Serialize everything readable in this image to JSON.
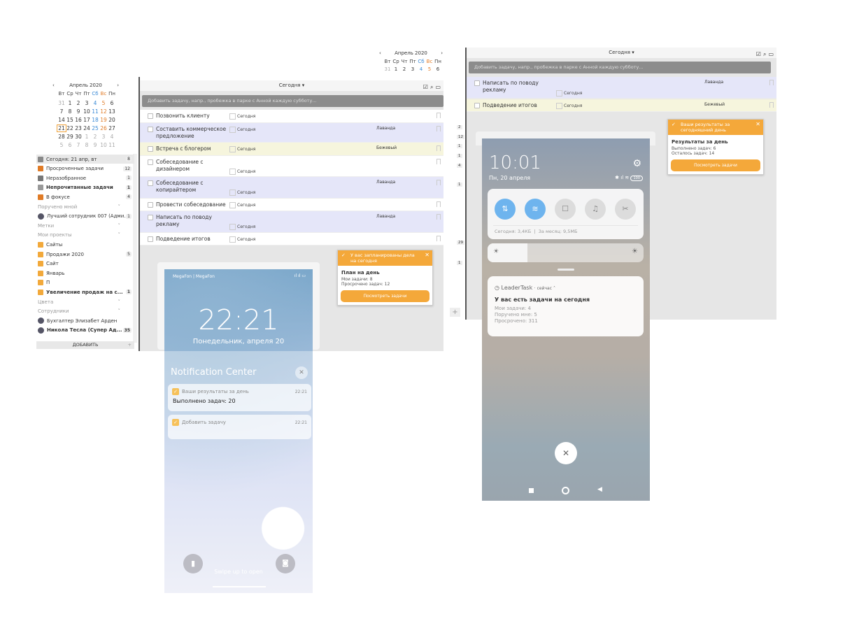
{
  "top_calendar": {
    "month": "Апрель 2020",
    "weekdays": [
      "Вт",
      "Ср",
      "Чт",
      "Пт",
      "Сб",
      "Вс",
      "Пн"
    ],
    "days": [
      "31",
      "1",
      "2",
      "3",
      "4",
      "5",
      "6"
    ]
  },
  "left_calendar": {
    "month": "Апрель 2020",
    "weekdays": [
      "Вт",
      "Ср",
      "Чт",
      "Пт",
      "Сб",
      "Вс",
      "Пн"
    ],
    "weeks": [
      [
        "31",
        "1",
        "2",
        "3",
        "4",
        "5",
        "6"
      ],
      [
        "7",
        "8",
        "9",
        "10",
        "11",
        "12",
        "13"
      ],
      [
        "14",
        "15",
        "16",
        "17",
        "18",
        "19",
        "20"
      ],
      [
        "21",
        "22",
        "23",
        "24",
        "25",
        "26",
        "27"
      ],
      [
        "28",
        "29",
        "30",
        "1",
        "2",
        "3",
        "4"
      ],
      [
        "5",
        "6",
        "7",
        "8",
        "9",
        "10",
        "11"
      ]
    ],
    "today": "21"
  },
  "sidebar": {
    "items": [
      {
        "label": "Сегодня: 21 апр, вт",
        "badge": "8",
        "icon": "calendar-icon",
        "type": "item"
      },
      {
        "label": "Просроченные задачи",
        "badge": "12",
        "icon": "overdue-icon",
        "type": "item"
      },
      {
        "label": "Неразобранное",
        "badge": "1",
        "icon": "inbox-icon",
        "type": "item"
      },
      {
        "label": "Непрочитанные задачи",
        "badge": "1",
        "icon": "bell-icon",
        "type": "bold"
      },
      {
        "label": "В фокусе",
        "badge": "4",
        "icon": "bookmark-icon",
        "type": "item"
      },
      {
        "label": "Поручено мной",
        "badge": "",
        "icon": "",
        "type": "section"
      },
      {
        "label": "Лучший сотрудник 007 (Адми...",
        "badge": "1",
        "icon": "avatar-icon",
        "type": "item"
      },
      {
        "label": "Метки",
        "badge": "",
        "icon": "",
        "type": "section"
      },
      {
        "label": "Мои проекты",
        "badge": "",
        "icon": "",
        "type": "section"
      },
      {
        "label": "Сайты",
        "badge": "",
        "icon": "folder-icon",
        "type": "item"
      },
      {
        "label": "Продажи 2020",
        "badge": "5",
        "icon": "folder-icon",
        "type": "item"
      },
      {
        "label": "Сайт",
        "badge": "",
        "icon": "folder-icon",
        "type": "item"
      },
      {
        "label": "Январь",
        "badge": "",
        "icon": "folder-icon",
        "type": "item"
      },
      {
        "label": "П",
        "badge": "",
        "icon": "folder-icon",
        "type": "item"
      },
      {
        "label": "Увеличение продаж на с...",
        "badge": "1",
        "icon": "folder-icon",
        "type": "bold"
      },
      {
        "label": "Цвета",
        "badge": "",
        "icon": "",
        "type": "section"
      },
      {
        "label": "Сотрудники",
        "badge": "",
        "icon": "",
        "type": "section"
      },
      {
        "label": "Бухгалтер Элизабет Арден",
        "badge": "",
        "icon": "avatar-icon",
        "type": "item"
      },
      {
        "label": "Никола Тесла (Супер Ад...",
        "badge": "35",
        "icon": "avatar-icon",
        "type": "bold"
      }
    ],
    "add_label": "ДОБАВИТЬ"
  },
  "main": {
    "view": "Сегодня",
    "input_placeholder": "Добавить задачу, напр., пробежка в парке с Анной каждую субботу...",
    "tasks": [
      {
        "title": "Позвонить клиенту",
        "date": "Сегодня",
        "tag": "",
        "color": "white"
      },
      {
        "title": "Составить коммерческое предложение",
        "date": "Сегодня",
        "tag": "Лаванда",
        "color": "lavender"
      },
      {
        "title": "Встреча с блогером",
        "date": "Сегодня",
        "tag": "Бежевый",
        "color": "beige"
      },
      {
        "title": "Собеседование с дизайнером",
        "date": "Сегодня",
        "tag": "",
        "color": "white"
      },
      {
        "title": "Собеседование с копирайтером",
        "date": "Сегодня",
        "tag": "Лаванда",
        "color": "lavender"
      },
      {
        "title": "Провести собеседование",
        "date": "Сегодня",
        "tag": "",
        "color": "white"
      },
      {
        "title": "Написать по поводу рекламу",
        "date": "Сегодня",
        "tag": "Лаванда",
        "color": "lavender"
      },
      {
        "title": "Подведение итогов",
        "date": "Сегодня",
        "tag": "",
        "color": "white"
      }
    ],
    "popup": {
      "header": "У вас запланированы дела на сегодня",
      "title": "План на день",
      "lines": [
        "Мои задачи: 8",
        "Просрочено задач: 12"
      ],
      "button": "Посмотреть задачи"
    }
  },
  "right": {
    "view": "Сегодня",
    "input_placeholder": "Добавить задачу, напр., пробежка в парке с Анной каждую субботу...",
    "tasks": [
      {
        "title": "Написать по поводу рекламу",
        "date": "Сегодня",
        "tag": "Лаванда",
        "color": "lavender"
      },
      {
        "title": "Подведение итогов",
        "date": "Сегодня",
        "tag": "Бежевый",
        "color": "beige"
      }
    ],
    "side_badges": [
      "2",
      "12",
      "1",
      "1",
      "4",
      "1",
      "29",
      "1"
    ],
    "popup": {
      "header": "Ваши результаты за сегодняшний день",
      "title": "Результаты за день",
      "lines": [
        "Выполнено задач: 6",
        "Осталось задач: 14"
      ],
      "button": "Посмотреть задачи"
    }
  },
  "phone_left": {
    "carrier": "MegaFon | MegaFon",
    "time": "22:21",
    "date": "Понедельник, апреля 20",
    "nc_title": "Notification Center",
    "notifications": [
      {
        "title": "Ваши результаты за день",
        "time": "22:21",
        "body": "Выполнено задач: 20"
      },
      {
        "title": "Добавить задачу",
        "time": "22:21",
        "body": ""
      }
    ],
    "swipe": "Swipe up to open"
  },
  "phone_right": {
    "time": "10:01",
    "date": "Пн, 20 апреля",
    "battery": "100",
    "data_today": "Сегодня: 3,4КБ",
    "data_month": "За месяц: 9,5МБ",
    "notification": {
      "app": "LeaderTask",
      "when": "сейчас",
      "title": "У вас есть задачи на сегодня",
      "lines": [
        "Мои задачи: 4",
        "Поручено мне: 5",
        "Просрочено: 311"
      ]
    }
  },
  "colors": {
    "accent": "#f4a83a",
    "lavender": "#e5e6f9",
    "beige": "#f6f5dd",
    "toggle_on": "#6eb4ee"
  }
}
